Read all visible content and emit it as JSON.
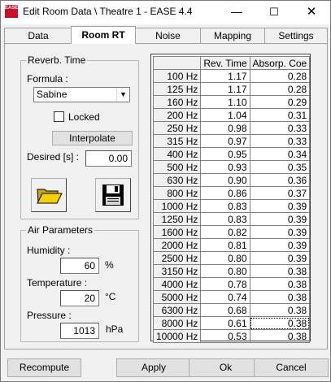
{
  "window": {
    "title": "Edit Room Data \\ Theatre 1 - EASE 4.4",
    "icon_text": "EASE"
  },
  "tabs": [
    {
      "label": "Data"
    },
    {
      "label": "Room RT"
    },
    {
      "label": "Noise"
    },
    {
      "label": "Mapping"
    },
    {
      "label": "Settings"
    }
  ],
  "reverb": {
    "group_title": "Reverb. Time",
    "formula_label": "Formula :",
    "formula_value": "Sabine",
    "locked_label": "Locked",
    "locked": false,
    "interpolate_label": "Interpolate",
    "desired_label": "Desired [s] :",
    "desired_value": "0.00",
    "open_icon": "folder-open-icon",
    "save_icon": "floppy-disk-icon"
  },
  "air": {
    "group_title": "Air Parameters",
    "humidity_label": "Humidity :",
    "humidity_value": "60",
    "humidity_unit": "%",
    "temperature_label": "Temperature :",
    "temperature_value": "20",
    "temperature_unit": "°C",
    "pressure_label": "Pressure :",
    "pressure_value": "1013",
    "pressure_unit": "hPa"
  },
  "table": {
    "headers": [
      "Rev. Time",
      "Absorp. Coe"
    ],
    "rows": [
      [
        "100 Hz",
        "1.17",
        "0.28"
      ],
      [
        "125 Hz",
        "1.17",
        "0.28"
      ],
      [
        "160 Hz",
        "1.10",
        "0.29"
      ],
      [
        "200 Hz",
        "1.04",
        "0.31"
      ],
      [
        "250 Hz",
        "0.98",
        "0.33"
      ],
      [
        "315 Hz",
        "0.97",
        "0.33"
      ],
      [
        "400 Hz",
        "0.95",
        "0.34"
      ],
      [
        "500 Hz",
        "0.93",
        "0.35"
      ],
      [
        "630 Hz",
        "0.90",
        "0.36"
      ],
      [
        "800 Hz",
        "0.86",
        "0.37"
      ],
      [
        "1000 Hz",
        "0.83",
        "0.39"
      ],
      [
        "1250 Hz",
        "0.83",
        "0.39"
      ],
      [
        "1600 Hz",
        "0.82",
        "0.39"
      ],
      [
        "2000 Hz",
        "0.81",
        "0.39"
      ],
      [
        "2500 Hz",
        "0.80",
        "0.39"
      ],
      [
        "3150 Hz",
        "0.80",
        "0.38"
      ],
      [
        "4000 Hz",
        "0.78",
        "0.38"
      ],
      [
        "5000 Hz",
        "0.74",
        "0.38"
      ],
      [
        "6300 Hz",
        "0.68",
        "0.38"
      ],
      [
        "8000 Hz",
        "0.61",
        "0.38"
      ],
      [
        "10000 Hz",
        "0.53",
        "0.38"
      ]
    ]
  },
  "buttons": {
    "recompute": "Recompute",
    "apply": "Apply",
    "ok": "Ok",
    "cancel": "Cancel"
  },
  "colors": {
    "icon_red": "#c8102e",
    "folder_yellow": "#f4d000"
  }
}
